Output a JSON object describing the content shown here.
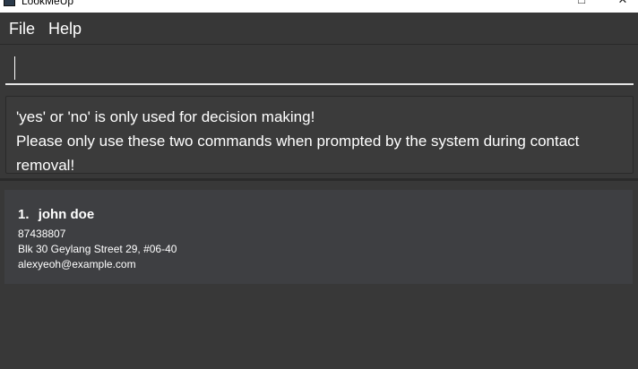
{
  "window": {
    "title": "LookMeUp",
    "maximize_glyph": "□",
    "close_glyph": "✕"
  },
  "menu": {
    "file": "File",
    "help": "Help"
  },
  "command": {
    "value": ""
  },
  "result": {
    "line1": "'yes' or 'no' is only used for decision making!",
    "line2": "Please only use these two commands when prompted by the system during contact removal!"
  },
  "persons": [
    {
      "index": "1.",
      "name": "john doe",
      "phone": "87438807",
      "address": "Blk 30 Geylang Street 29, #06-40",
      "email": "alexyeoh@example.com"
    }
  ],
  "colors": {
    "background": "#383838",
    "card": "#3e3f42",
    "text": "#ffffff"
  }
}
